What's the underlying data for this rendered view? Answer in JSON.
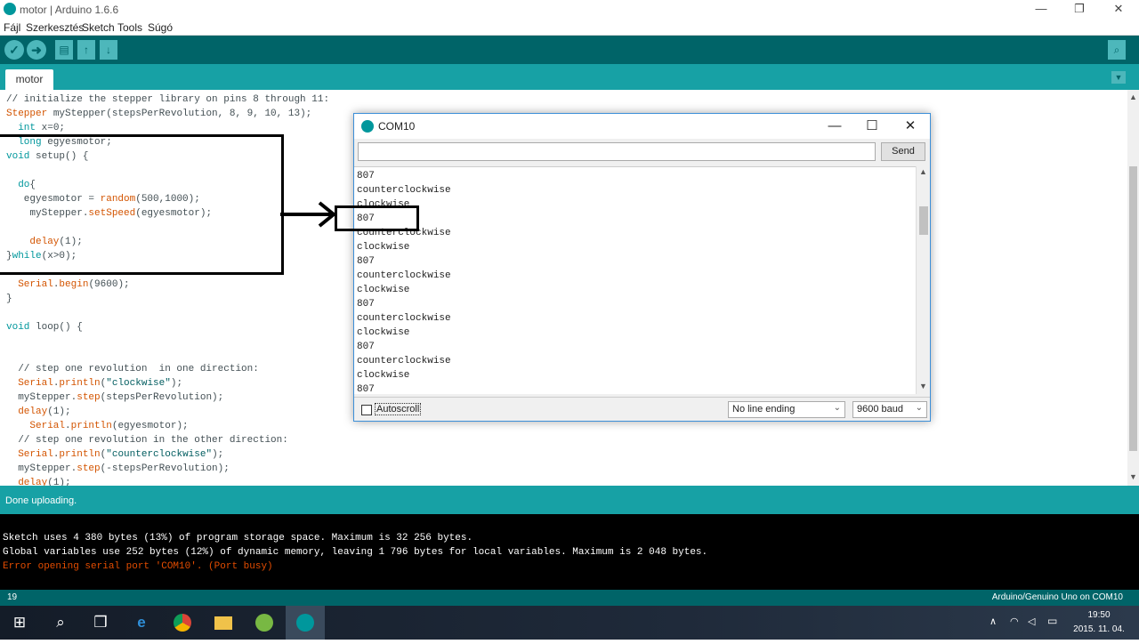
{
  "window": {
    "title": "motor | Arduino 1.6.6",
    "min_glyph": "—",
    "restore_glyph": "❐",
    "close_glyph": "✕"
  },
  "menu": [
    "Fájl",
    "Szerkesztés",
    "Sketch",
    "Tools",
    "Súgó"
  ],
  "toolbar": {
    "verify_icon": "✓",
    "upload_icon": "➜",
    "new_icon": "▤",
    "open_icon": "↑",
    "save_icon": "↓",
    "serial_monitor_icon": "⌕"
  },
  "tabs": [
    {
      "label": "motor"
    }
  ],
  "tab_menu_icon": "▼",
  "code": [
    "// initialize the stepper library on pins 8 through 11:",
    "Stepper myStepper(stepsPerRevolution, 8, 9, 10, 13);",
    "  int x=0;",
    "  long egyesmotor;",
    "void setup() {",
    "",
    "  do{",
    "   egyesmotor = random(500,1000);",
    "    myStepper.setSpeed(egyesmotor);",
    "",
    "    delay(1);",
    "}while(x>0);",
    "",
    "  Serial.begin(9600);",
    "}",
    "",
    "void loop() {",
    "",
    "",
    "  // step one revolution  in one direction:",
    "  Serial.println(\"clockwise\");",
    "  myStepper.step(stepsPerRevolution);",
    "  delay(1);",
    "    Serial.println(egyesmotor);",
    "  // step one revolution in the other direction:",
    "  Serial.println(\"counterclockwise\");",
    "  myStepper.step(-stepsPerRevolution);",
    "  delay(1);"
  ],
  "status": {
    "message": "Done uploading."
  },
  "console": {
    "lines": [
      "Sketch uses 4 380 bytes (13%) of program storage space. Maximum is 32 256 bytes.",
      "Global variables use 252 bytes (12%) of dynamic memory, leaving 1 796 bytes for local variables. Maximum is 2 048 bytes."
    ],
    "error": "Error opening serial port 'COM10'. (Port busy)",
    "error_color": "#e34c00"
  },
  "boardbar": {
    "line": "19",
    "board": "Arduino/Genuino Uno on COM10"
  },
  "serial_monitor": {
    "title": "COM10",
    "input_value": "",
    "send_label": "Send",
    "output": [
      "807",
      "counterclockwise",
      "clockwise",
      "807",
      "counterclockwise",
      "clockwise",
      "807",
      "counterclockwise",
      "clockwise",
      "807",
      "counterclockwise",
      "clockwise",
      "807",
      "counterclockwise",
      "clockwise",
      "807"
    ],
    "autoscroll_label": "Autoscroll",
    "autoscroll_checked": false,
    "line_ending": "No line ending",
    "baud": "9600 baud"
  },
  "taskbar": {
    "time": "19:50",
    "date": "2015. 11. 04.",
    "items": [
      "start",
      "search",
      "task-view",
      "edge",
      "chrome",
      "file-explorer",
      "utorrent",
      "arduino"
    ]
  },
  "colors": {
    "teal_dark": "#006468",
    "teal": "#17a1a5",
    "keyword": "#00979c",
    "function": "#d35400"
  }
}
